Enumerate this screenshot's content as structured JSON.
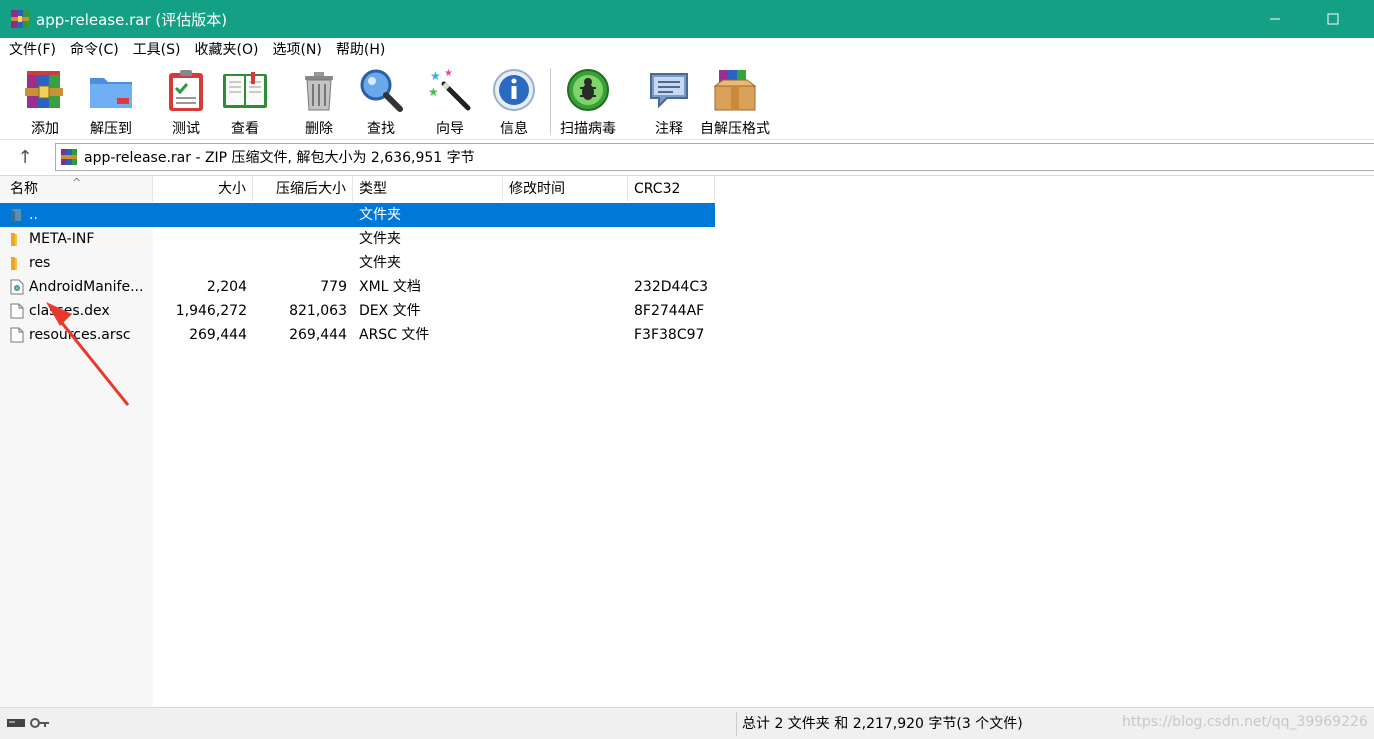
{
  "window": {
    "title": "app-release.rar (评估版本)",
    "minimize": "—",
    "maximize": "☐"
  },
  "menu": [
    "文件(F)",
    "命令(C)",
    "工具(S)",
    "收藏夹(O)",
    "选项(N)",
    "帮助(H)"
  ],
  "toolbar": {
    "add": "添加",
    "extract": "解压到",
    "test": "测试",
    "view": "查看",
    "delete": "删除",
    "find": "查找",
    "wizard": "向导",
    "info": "信息",
    "scan": "扫描病毒",
    "comment": "注释",
    "sfx": "自解压格式"
  },
  "address": {
    "up_glyph": "↑",
    "text": "app-release.rar - ZIP 压缩文件, 解包大小为 2,636,951 字节"
  },
  "columns": {
    "name": "名称",
    "size": "大小",
    "packed": "压缩后大小",
    "type": "类型",
    "modified": "修改时间",
    "crc": "CRC32",
    "sort_glyph": "^"
  },
  "files": [
    {
      "name": "..",
      "size": "",
      "packed": "",
      "type": "文件夹",
      "modified": "",
      "crc": "",
      "icon": "parent-folder-icon",
      "selected": true
    },
    {
      "name": "META-INF",
      "size": "",
      "packed": "",
      "type": "文件夹",
      "modified": "",
      "crc": "",
      "icon": "folder-icon",
      "selected": false
    },
    {
      "name": "res",
      "size": "",
      "packed": "",
      "type": "文件夹",
      "modified": "",
      "crc": "",
      "icon": "folder-icon",
      "selected": false
    },
    {
      "name": "AndroidManife...",
      "size": "2,204",
      "packed": "779",
      "type": "XML 文档",
      "modified": "",
      "crc": "232D44C3",
      "icon": "xml-file-icon",
      "selected": false
    },
    {
      "name": "classes.dex",
      "size": "1,946,272",
      "packed": "821,063",
      "type": "DEX 文件",
      "modified": "",
      "crc": "8F2744AF",
      "icon": "file-icon",
      "selected": false
    },
    {
      "name": "resources.arsc",
      "size": "269,444",
      "packed": "269,444",
      "type": "ARSC 文件",
      "modified": "",
      "crc": "F3F38C97",
      "icon": "file-icon",
      "selected": false
    }
  ],
  "status": {
    "text": "总计 2 文件夹 和 2,217,920 字节(3 个文件)",
    "watermark": "https://blog.csdn.net/qq_39969226"
  },
  "colors": {
    "titlebar": "#14a085",
    "selection": "#0078d7",
    "arrow": "#e8392e"
  }
}
